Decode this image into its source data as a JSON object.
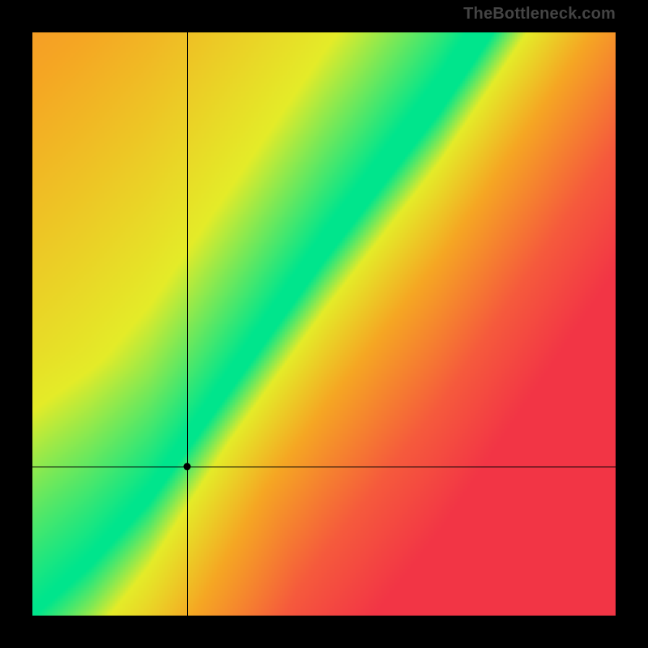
{
  "watermark": "TheBottleneck.com",
  "chart_data": {
    "type": "heatmap",
    "title": "",
    "xlabel": "",
    "ylabel": "",
    "x_range": [
      0,
      1
    ],
    "y_range": [
      0,
      1
    ],
    "grid": false,
    "annotations": {
      "crosshair": {
        "x": 0.265,
        "y": 0.255
      },
      "marker": {
        "x": 0.265,
        "y": 0.255
      }
    },
    "optimal_line": {
      "description": "Green diagonal band of best-balance region widening toward the top-right; band center approximated as y ≈ 1.35·x − 0.05 for x > 0.1, curving through origin for small x.",
      "points": [
        {
          "x": 0.0,
          "y": 0.0
        },
        {
          "x": 0.1,
          "y": 0.09
        },
        {
          "x": 0.2,
          "y": 0.2
        },
        {
          "x": 0.3,
          "y": 0.34
        },
        {
          "x": 0.4,
          "y": 0.48
        },
        {
          "x": 0.5,
          "y": 0.62
        },
        {
          "x": 0.6,
          "y": 0.75
        },
        {
          "x": 0.7,
          "y": 0.88
        },
        {
          "x": 0.78,
          "y": 1.0
        }
      ]
    },
    "color_scale": {
      "description": "Red→orange→yellow→green; green at optimum, red at worst bottleneck.",
      "stops": [
        {
          "value": 0.0,
          "color": "#00E58C"
        },
        {
          "value": 0.12,
          "color": "#E4EB28"
        },
        {
          "value": 0.35,
          "color": "#F5A623"
        },
        {
          "value": 0.7,
          "color": "#F55A3C"
        },
        {
          "value": 1.0,
          "color": "#F23545"
        }
      ]
    }
  }
}
